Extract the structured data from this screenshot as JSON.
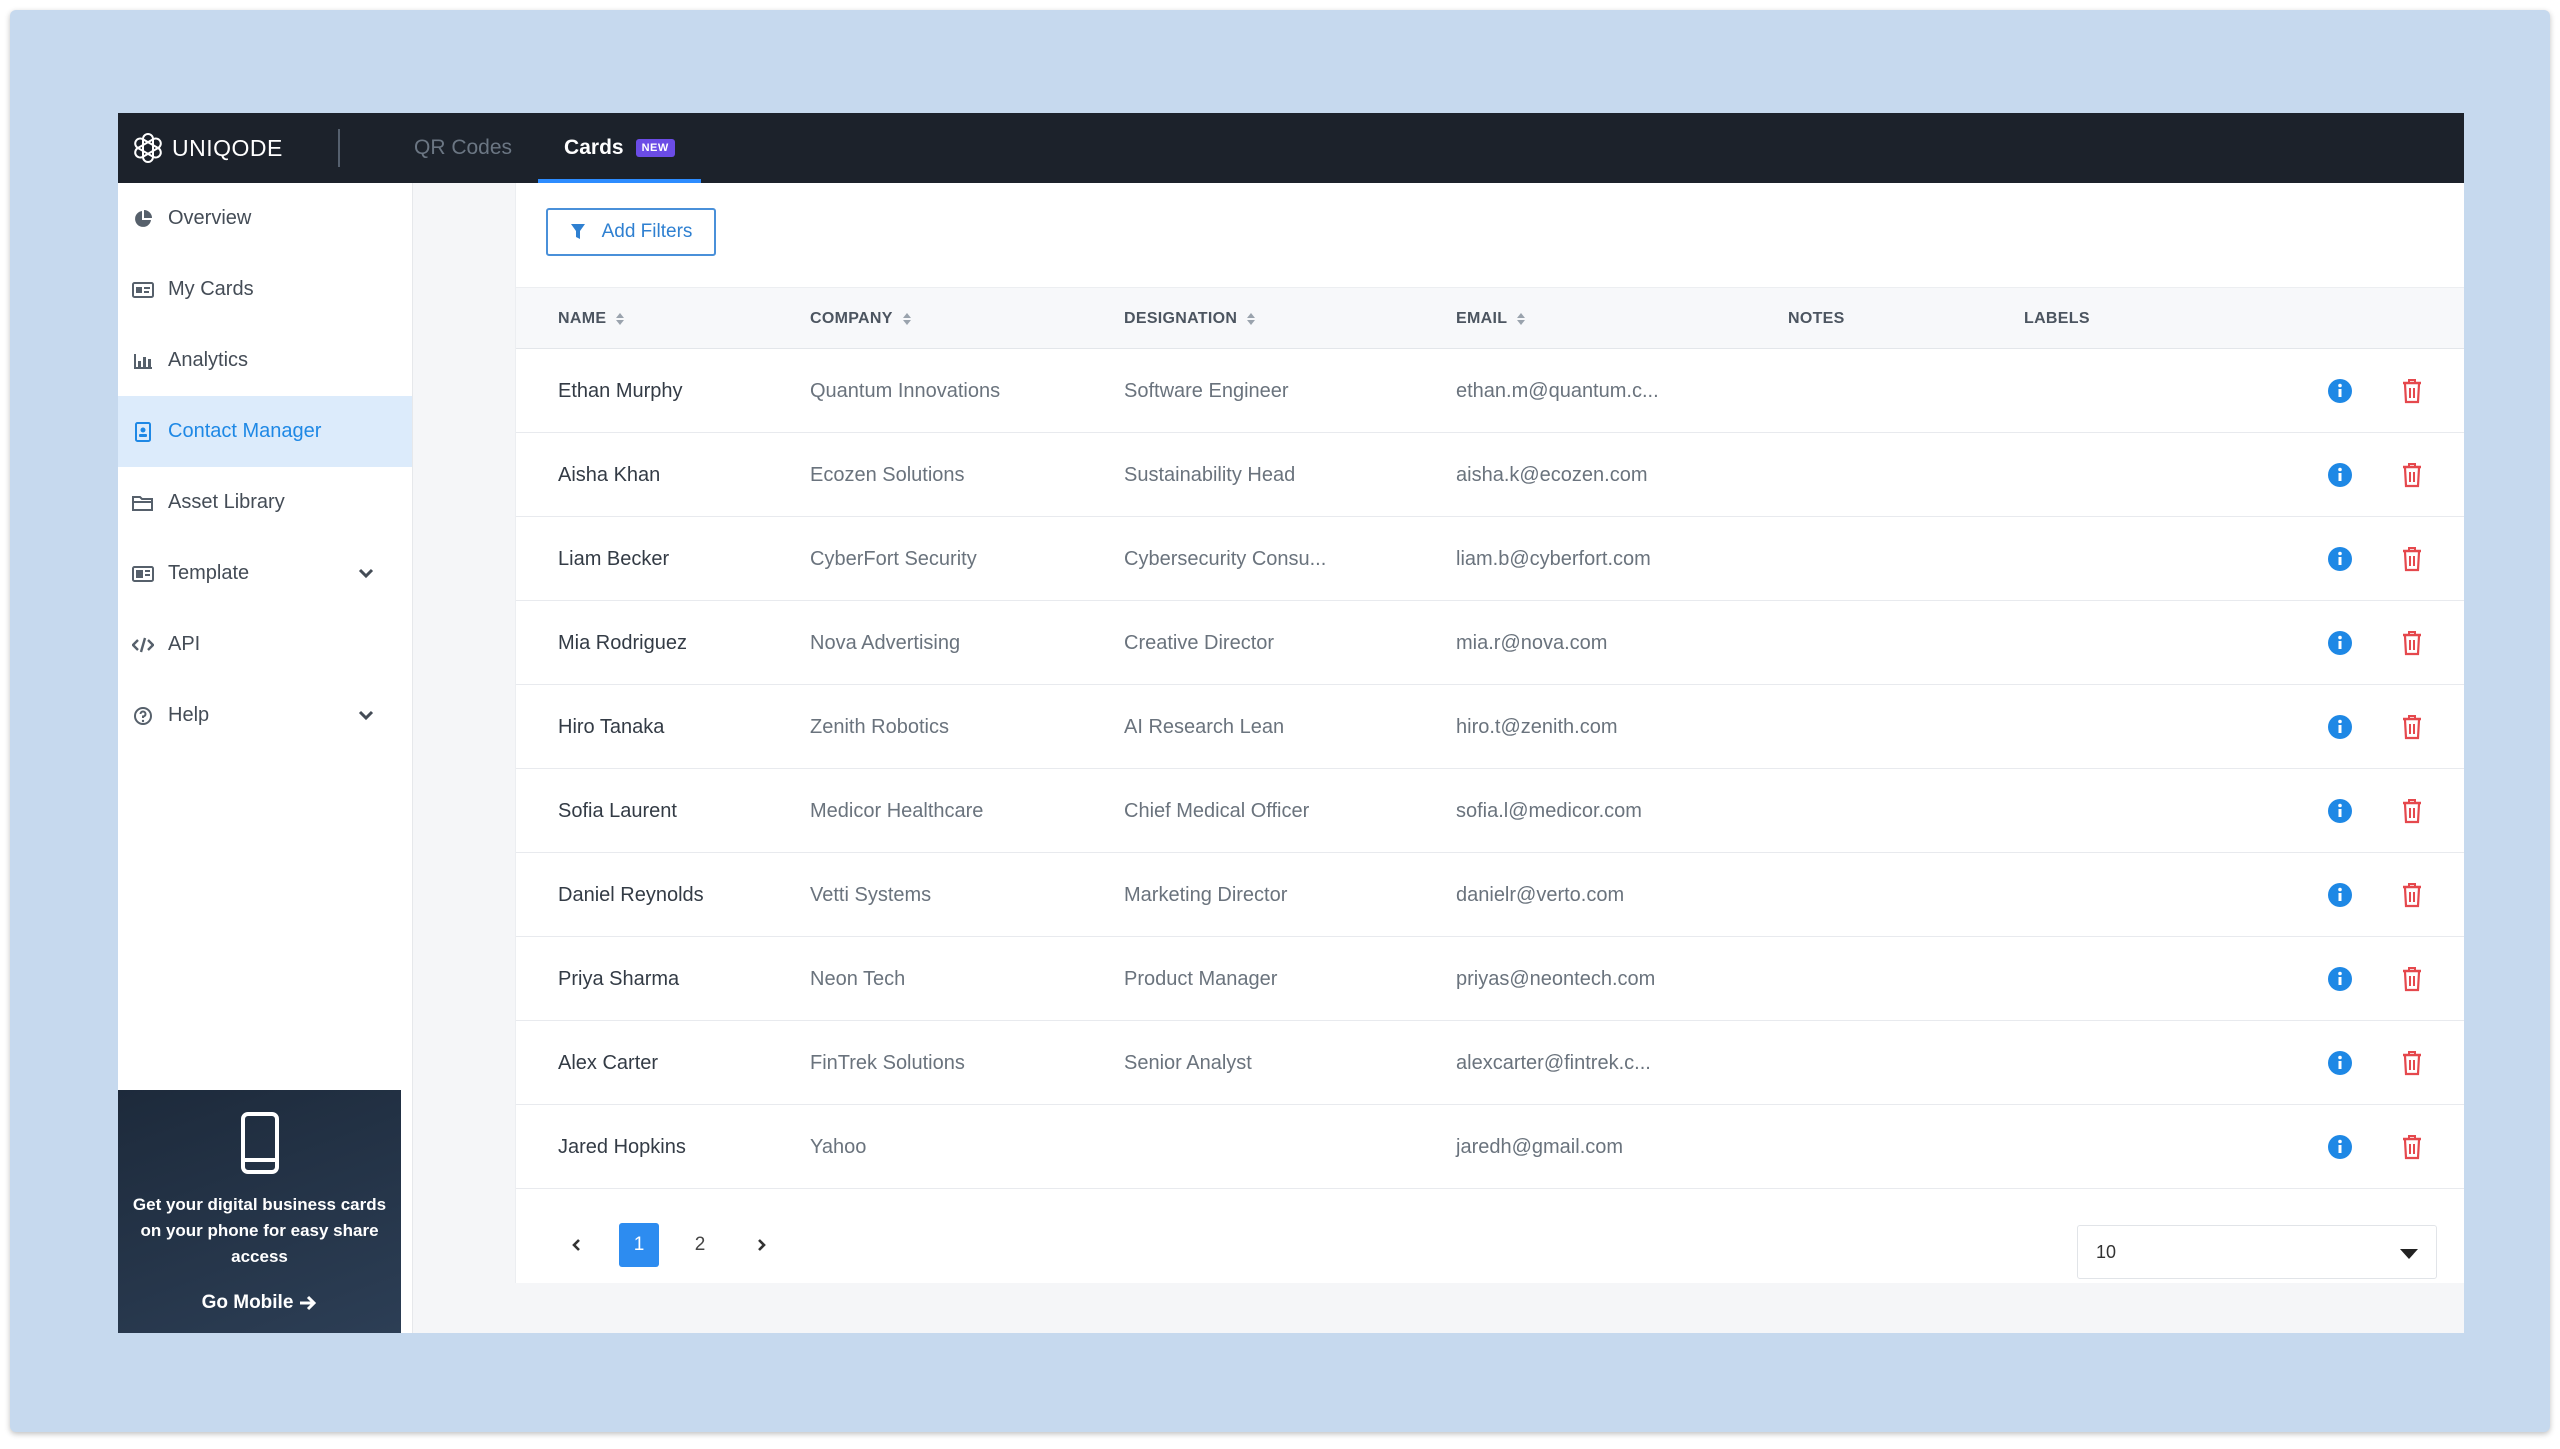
{
  "app": {
    "brand": "UNIQODE"
  },
  "topnav": {
    "tabs": [
      {
        "label": "QR Codes"
      },
      {
        "label": "Cards",
        "badge": "NEW"
      }
    ]
  },
  "sidebar": {
    "items": [
      {
        "label": "Overview",
        "icon": "pie-chart-icon"
      },
      {
        "label": "My Cards",
        "icon": "id-card-icon"
      },
      {
        "label": "Analytics",
        "icon": "bar-chart-icon"
      },
      {
        "label": "Contact Manager",
        "icon": "contacts-icon"
      },
      {
        "label": "Asset Library",
        "icon": "folder-icon"
      },
      {
        "label": "Template",
        "icon": "template-icon"
      },
      {
        "label": "API",
        "icon": "code-icon"
      },
      {
        "label": "Help",
        "icon": "help-icon"
      }
    ],
    "promo": {
      "text": "Get your digital business cards on your phone for easy share access",
      "link": "Go Mobile"
    }
  },
  "toolbar": {
    "add_filters": "Add Filters"
  },
  "table": {
    "headers": {
      "name": "NAME",
      "company": "COMPANY",
      "designation": "DESIGNATION",
      "email": "EMAIL",
      "notes": "NOTES",
      "labels": "LABELS"
    },
    "rows": [
      {
        "name": "Ethan Murphy",
        "company": "Quantum Innovations",
        "designation": "Software Engineer",
        "email": "ethan.m@quantum.c..."
      },
      {
        "name": "Aisha Khan",
        "company": "Ecozen Solutions",
        "designation": "Sustainability Head",
        "email": "aisha.k@ecozen.com"
      },
      {
        "name": "Liam Becker",
        "company": "CyberFort Security",
        "designation": "Cybersecurity Consu...",
        "email": "liam.b@cyberfort.com"
      },
      {
        "name": "Mia Rodriguez",
        "company": "Nova Advertising",
        "designation": "Creative Director",
        "email": "mia.r@nova.com"
      },
      {
        "name": "Hiro Tanaka",
        "company": "Zenith Robotics",
        "designation": "AI Research Lean",
        "email": "hiro.t@zenith.com"
      },
      {
        "name": "Sofia Laurent",
        "company": "Medicor Healthcare",
        "designation": "Chief Medical Officer",
        "email": "sofia.l@medicor.com"
      },
      {
        "name": "Daniel Reynolds",
        "company": "Vetti Systems",
        "designation": "Marketing Director",
        "email": "danielr@verto.com"
      },
      {
        "name": "Priya Sharma",
        "company": "Neon Tech",
        "designation": "Product Manager",
        "email": "priyas@neontech.com"
      },
      {
        "name": "Alex Carter",
        "company": "FinTrek Solutions",
        "designation": "Senior Analyst",
        "email": "alexcarter@fintrek.c..."
      },
      {
        "name": "Jared Hopkins",
        "company": "Yahoo",
        "designation": "",
        "email": "jaredh@gmail.com"
      }
    ]
  },
  "pagination": {
    "pages": [
      "1",
      "2"
    ],
    "current": "1",
    "page_size": "10"
  },
  "colors": {
    "accent": "#2d8cf0",
    "topbar": "#1c222b",
    "delete": "#e5484d",
    "info": "#1e88e5",
    "frame": "#c6d9ee"
  }
}
